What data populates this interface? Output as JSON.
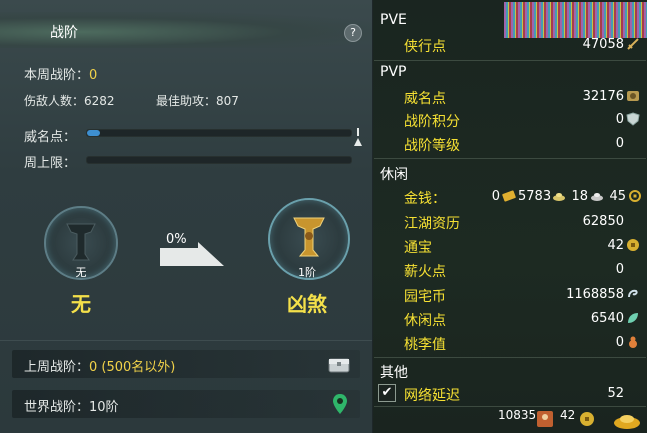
{
  "panel": {
    "title": "战阶",
    "help": "?",
    "this_week_label": "本周战阶：",
    "this_week_value": "0",
    "kills_label": "伤敌人数：",
    "kills_value": "6282",
    "best_assist_label": "最佳助攻：",
    "best_assist_value": "807",
    "reputation_label": "威名点：",
    "reputation_progress": 0.05,
    "weekly_cap_label": "周上限：",
    "weekly_cap_progress": 0,
    "current_tier_level": "无",
    "current_tier_name": "无",
    "progress_pct": "0%",
    "next_tier_level": "1阶",
    "next_tier_name": "凶煞",
    "last_week_label": "上周战阶：",
    "last_week_value": "0 (500名以外)",
    "world_label": "世界战阶：",
    "world_value": "10阶"
  },
  "stats": {
    "pve_header": "PVE",
    "pve": [
      {
        "label": "侠行点",
        "value": "47058",
        "icon": "sword-icon"
      }
    ],
    "pvp_header": "PVP",
    "pvp": [
      {
        "label": "威名点",
        "value": "32176",
        "icon": "crest-icon"
      },
      {
        "label": "战阶积分",
        "value": "0",
        "icon": "shield-icon"
      },
      {
        "label": "战阶等级",
        "value": "0",
        "icon": ""
      }
    ],
    "leisure_header": "休闲",
    "money_label": "金钱：",
    "money_gold": "0",
    "money_silver": "5783",
    "money_copper1": "18",
    "money_copper2": "45",
    "leisure": [
      {
        "label": "江湖资历",
        "value": "62850",
        "icon": ""
      },
      {
        "label": "通宝",
        "value": "42",
        "icon": "coin-icon"
      },
      {
        "label": "薪火点",
        "value": "0",
        "icon": ""
      },
      {
        "label": "园宅币",
        "value": "1168858",
        "icon": "house-coin-icon"
      },
      {
        "label": "休闲点",
        "value": "6540",
        "icon": "leaf-icon"
      },
      {
        "label": "桃李值",
        "value": "0",
        "icon": "gourd-icon"
      }
    ],
    "other_header": "其他",
    "network_label": "网络延迟",
    "network_value": "52"
  },
  "footer": {
    "value1": "10835",
    "value2": "42"
  },
  "colors": {
    "accent_yellow": "#f5e033",
    "bar_blue": "#3e8fd0"
  }
}
